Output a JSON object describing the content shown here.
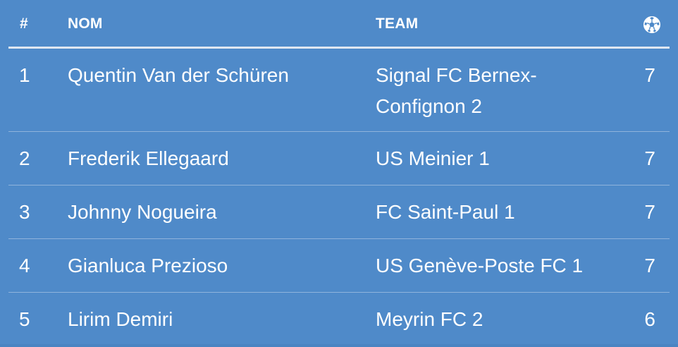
{
  "columns": {
    "rank": "#",
    "name": "NOM",
    "team": "TEAM",
    "goals_icon": "soccer-ball-icon"
  },
  "rows": [
    {
      "rank": "1",
      "name": "Quentin Van der Schüren",
      "team": "Signal FC Bernex-Confignon 2",
      "goals": "7"
    },
    {
      "rank": "2",
      "name": "Frederik Ellegaard",
      "team": "US Meinier 1",
      "goals": "7"
    },
    {
      "rank": "3",
      "name": "Johnny Nogueira",
      "team": "FC Saint-Paul 1",
      "goals": "7"
    },
    {
      "rank": "4",
      "name": "Gianluca Prezioso",
      "team": "US Genève-Poste FC 1",
      "goals": "7"
    },
    {
      "rank": "5",
      "name": "Lirim Demiri",
      "team": "Meyrin FC 2",
      "goals": "6"
    }
  ],
  "colors": {
    "background": "#4f8ac9",
    "text": "#ffffff",
    "header_divider": "#dfe7f1",
    "row_divider": "#8fb3dc"
  }
}
